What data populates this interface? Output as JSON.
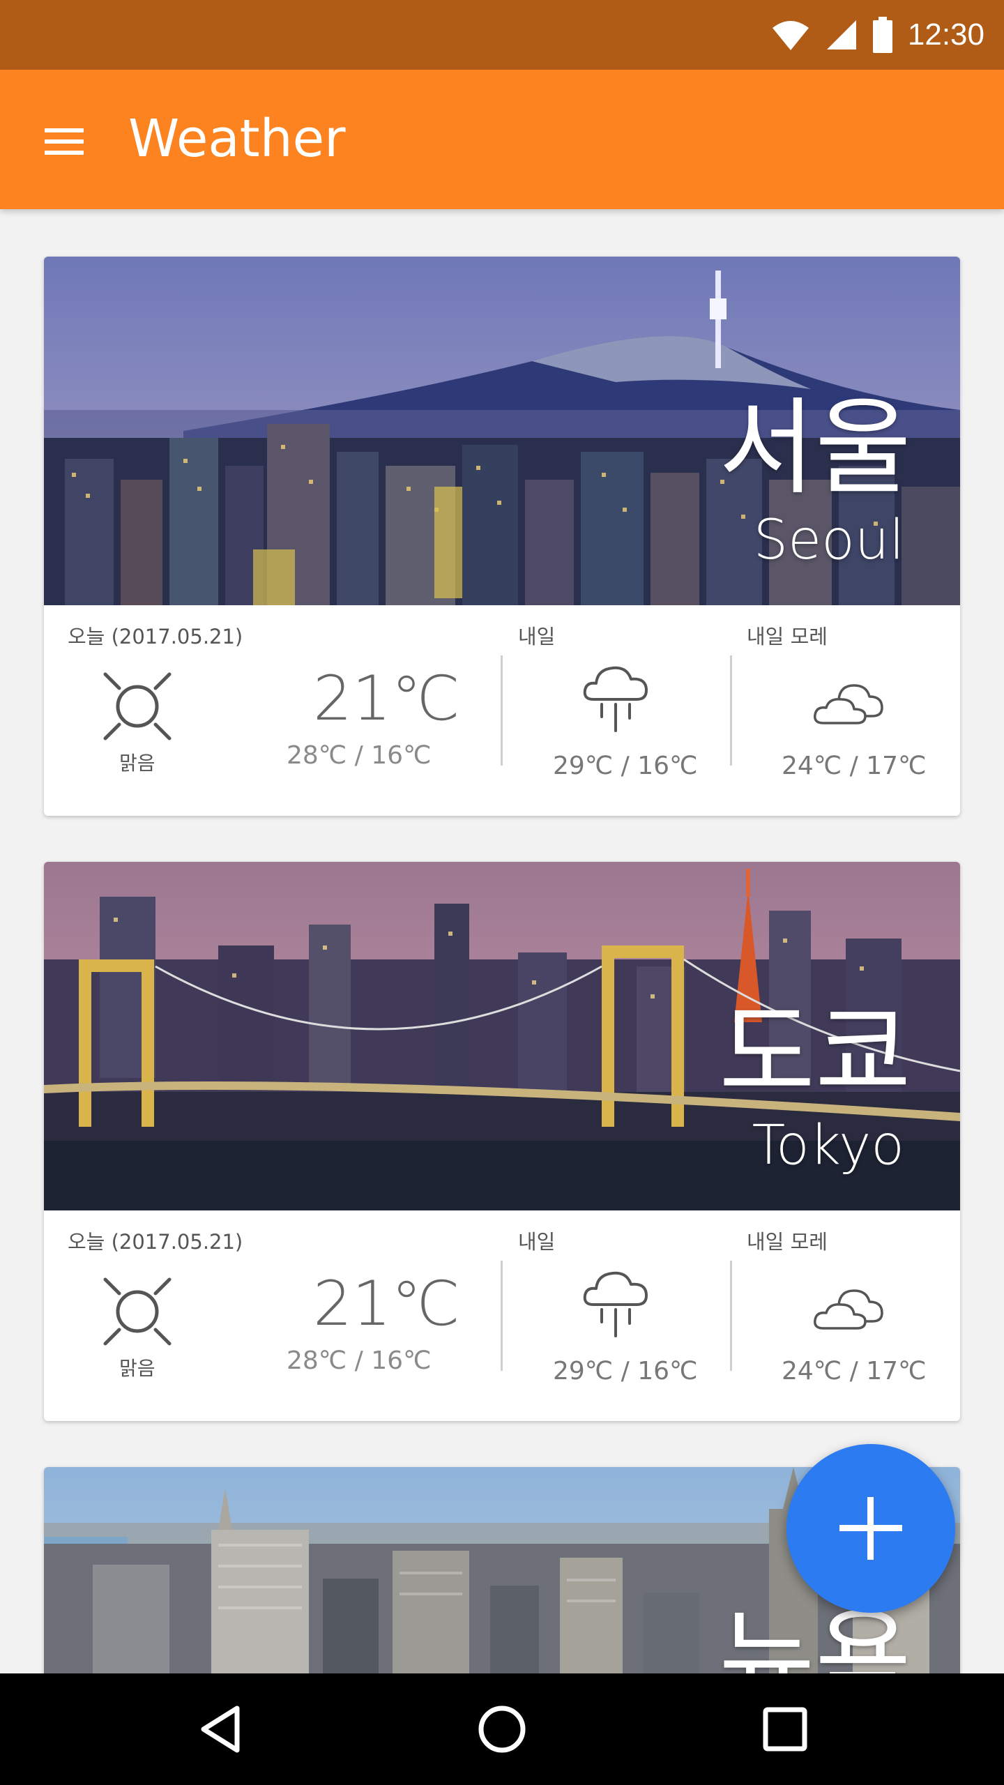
{
  "status_bar": {
    "time": "12:30"
  },
  "app_bar": {
    "title": "Weather"
  },
  "cities": [
    {
      "name_ko": "서울",
      "name_en": "Seoul",
      "today_label": "오늘 (2017.05.21)",
      "today_condition": "맑음",
      "today_temp": "21℃",
      "today_range": "28℃ / 16℃",
      "tomorrow_label": "내일",
      "tomorrow_range": "29℃ / 16℃",
      "day_after_label": "내일 모레",
      "day_after_range": "24℃ / 17℃"
    },
    {
      "name_ko": "도쿄",
      "name_en": "Tokyo",
      "today_label": "오늘 (2017.05.21)",
      "today_condition": "맑음",
      "today_temp": "21℃",
      "today_range": "28℃ / 16℃",
      "tomorrow_label": "내일",
      "tomorrow_range": "29℃ / 16℃",
      "day_after_label": "내일 모레",
      "day_after_range": "24℃ / 17℃"
    },
    {
      "name_ko": "뉴욕"
    }
  ],
  "icons": {
    "menu": "menu-icon",
    "sun": "sun-icon",
    "rain": "rain-cloud-icon",
    "cloud": "cloud-icon",
    "add": "plus-icon",
    "wifi": "wifi-icon",
    "signal": "signal-icon",
    "battery": "battery-icon"
  },
  "colors": {
    "status_bar": "#b05c17",
    "app_bar": "#fd8321",
    "fab": "#2d7bf0",
    "background": "#f2f2f2"
  }
}
